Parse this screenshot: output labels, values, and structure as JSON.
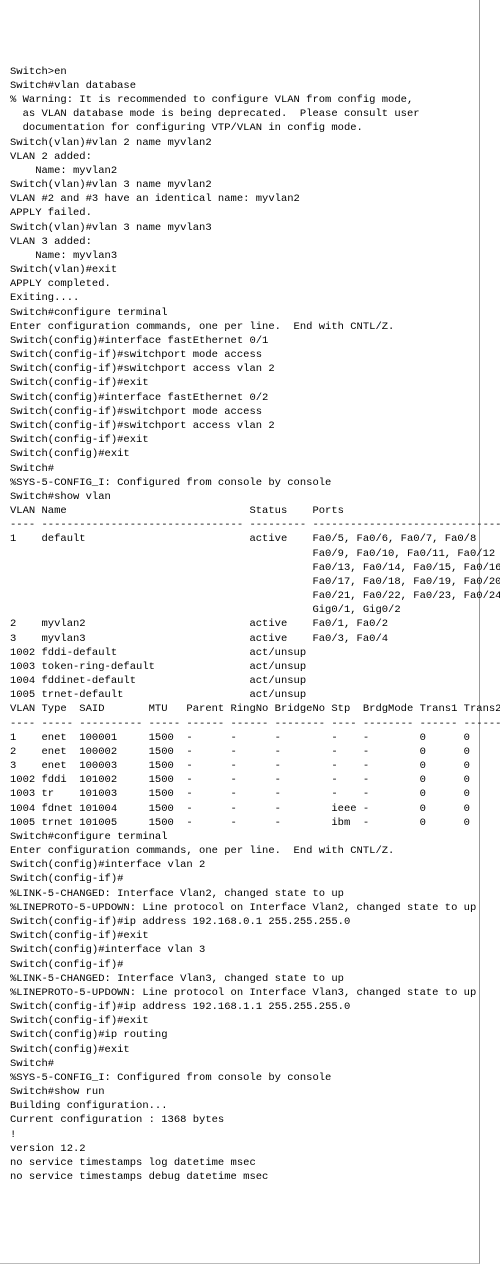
{
  "lines": [
    "Switch>en",
    "Switch#vlan database",
    "% Warning: It is recommended to configure VLAN from config mode,",
    "  as VLAN database mode is being deprecated.  Please consult user",
    "  documentation for configuring VTP/VLAN in config mode.",
    "",
    "Switch(vlan)#vlan 2 name myvlan2",
    "VLAN 2 added:",
    "    Name: myvlan2",
    "Switch(vlan)#vlan 3 name myvlan2",
    "VLAN #2 and #3 have an identical name: myvlan2",
    "APPLY failed.",
    "Switch(vlan)#vlan 3 name myvlan3",
    "VLAN 3 added:",
    "    Name: myvlan3",
    "Switch(vlan)#exit",
    "APPLY completed.",
    "Exiting....",
    "Switch#configure terminal",
    "Enter configuration commands, one per line.  End with CNTL/Z.",
    "Switch(config)#interface fastEthernet 0/1",
    "Switch(config-if)#switchport mode access",
    "Switch(config-if)#switchport access vlan 2",
    "Switch(config-if)#exit",
    "Switch(config)#interface fastEthernet 0/2",
    "Switch(config-if)#switchport mode access",
    "Switch(config-if)#switchport access vlan 2",
    "Switch(config-if)#exit",
    "Switch(config)#exit",
    "Switch#",
    "%SYS-5-CONFIG_I: Configured from console by console",
    "",
    "Switch#show vlan",
    "",
    "VLAN Name                             Status    Ports",
    "---- -------------------------------- --------- -------------------------------",
    "1    default                          active    Fa0/5, Fa0/6, Fa0/7, Fa0/8",
    "                                                Fa0/9, Fa0/10, Fa0/11, Fa0/12",
    "                                                Fa0/13, Fa0/14, Fa0/15, Fa0/16",
    "                                                Fa0/17, Fa0/18, Fa0/19, Fa0/20",
    "                                                Fa0/21, Fa0/22, Fa0/23, Fa0/24",
    "                                                Gig0/1, Gig0/2",
    "2    myvlan2                          active    Fa0/1, Fa0/2",
    "3    myvlan3                          active    Fa0/3, Fa0/4",
    "1002 fddi-default                     act/unsup",
    "1003 token-ring-default               act/unsup",
    "1004 fddinet-default                  act/unsup",
    "1005 trnet-default                    act/unsup",
    "",
    "VLAN Type  SAID       MTU   Parent RingNo BridgeNo Stp  BrdgMode Trans1 Trans2",
    "---- ----- ---------- ----- ------ ------ -------- ---- -------- ------ ------",
    "1    enet  100001     1500  -      -      -        -    -        0      0",
    "2    enet  100002     1500  -      -      -        -    -        0      0",
    "3    enet  100003     1500  -      -      -        -    -        0      0",
    "1002 fddi  101002     1500  -      -      -        -    -        0      0",
    "1003 tr    101003     1500  -      -      -        -    -        0      0",
    "1004 fdnet 101004     1500  -      -      -        ieee -        0      0",
    "1005 trnet 101005     1500  -      -      -        ibm  -        0      0",
    "",
    "Switch#configure terminal",
    "Enter configuration commands, one per line.  End with CNTL/Z.",
    "Switch(config)#interface vlan 2",
    "Switch(config-if)#",
    "%LINK-5-CHANGED: Interface Vlan2, changed state to up",
    "",
    "%LINEPROTO-5-UPDOWN: Line protocol on Interface Vlan2, changed state to up",
    "",
    "Switch(config-if)#ip address 192.168.0.1 255.255.255.0",
    "Switch(config-if)#exit",
    "Switch(config)#interface vlan 3",
    "Switch(config-if)#",
    "%LINK-5-CHANGED: Interface Vlan3, changed state to up",
    "",
    "%LINEPROTO-5-UPDOWN: Line protocol on Interface Vlan3, changed state to up",
    "",
    "Switch(config-if)#ip address 192.168.1.1 255.255.255.0",
    "Switch(config-if)#exit",
    "Switch(config)#ip routing",
    "Switch(config)#exit",
    "Switch#",
    "%SYS-5-CONFIG_I: Configured from console by console",
    "",
    "Switch#show run",
    "Building configuration...",
    "",
    "Current configuration : 1368 bytes",
    "!",
    "version 12.2",
    "no service timestamps log datetime msec",
    "no service timestamps debug datetime msec"
  ],
  "vlan_name_table": {
    "headers": [
      "VLAN",
      "Name",
      "Status",
      "Ports"
    ],
    "rows": [
      {
        "vlan": "1",
        "name": "default",
        "status": "active",
        "ports": "Fa0/5, Fa0/6, Fa0/7, Fa0/8, Fa0/9, Fa0/10, Fa0/11, Fa0/12, Fa0/13, Fa0/14, Fa0/15, Fa0/16, Fa0/17, Fa0/18, Fa0/19, Fa0/20, Fa0/21, Fa0/22, Fa0/23, Fa0/24, Gig0/1, Gig0/2"
      },
      {
        "vlan": "2",
        "name": "myvlan2",
        "status": "active",
        "ports": "Fa0/1, Fa0/2"
      },
      {
        "vlan": "3",
        "name": "myvlan3",
        "status": "active",
        "ports": "Fa0/3, Fa0/4"
      },
      {
        "vlan": "1002",
        "name": "fddi-default",
        "status": "act/unsup",
        "ports": ""
      },
      {
        "vlan": "1003",
        "name": "token-ring-default",
        "status": "act/unsup",
        "ports": ""
      },
      {
        "vlan": "1004",
        "name": "fddinet-default",
        "status": "act/unsup",
        "ports": ""
      },
      {
        "vlan": "1005",
        "name": "trnet-default",
        "status": "act/unsup",
        "ports": ""
      }
    ]
  },
  "vlan_type_table": {
    "headers": [
      "VLAN",
      "Type",
      "SAID",
      "MTU",
      "Parent",
      "RingNo",
      "BridgeNo",
      "Stp",
      "BrdgMode",
      "Trans1",
      "Trans2"
    ],
    "rows": [
      {
        "vlan": "1",
        "type": "enet",
        "said": "100001",
        "mtu": "1500",
        "parent": "-",
        "ringno": "-",
        "bridgeno": "-",
        "stp": "-",
        "brdgmode": "-",
        "trans1": "0",
        "trans2": "0"
      },
      {
        "vlan": "2",
        "type": "enet",
        "said": "100002",
        "mtu": "1500",
        "parent": "-",
        "ringno": "-",
        "bridgeno": "-",
        "stp": "-",
        "brdgmode": "-",
        "trans1": "0",
        "trans2": "0"
      },
      {
        "vlan": "3",
        "type": "enet",
        "said": "100003",
        "mtu": "1500",
        "parent": "-",
        "ringno": "-",
        "bridgeno": "-",
        "stp": "-",
        "brdgmode": "-",
        "trans1": "0",
        "trans2": "0"
      },
      {
        "vlan": "1002",
        "type": "fddi",
        "said": "101002",
        "mtu": "1500",
        "parent": "-",
        "ringno": "-",
        "bridgeno": "-",
        "stp": "-",
        "brdgmode": "-",
        "trans1": "0",
        "trans2": "0"
      },
      {
        "vlan": "1003",
        "type": "tr",
        "said": "101003",
        "mtu": "1500",
        "parent": "-",
        "ringno": "-",
        "bridgeno": "-",
        "stp": "-",
        "brdgmode": "-",
        "trans1": "0",
        "trans2": "0"
      },
      {
        "vlan": "1004",
        "type": "fdnet",
        "said": "101004",
        "mtu": "1500",
        "parent": "-",
        "ringno": "-",
        "bridgeno": "-",
        "stp": "ieee",
        "brdgmode": "-",
        "trans1": "0",
        "trans2": "0"
      },
      {
        "vlan": "1005",
        "type": "trnet",
        "said": "101005",
        "mtu": "1500",
        "parent": "-",
        "ringno": "-",
        "bridgeno": "-",
        "stp": "ibm",
        "brdgmode": "-",
        "trans1": "0",
        "trans2": "0"
      }
    ]
  }
}
